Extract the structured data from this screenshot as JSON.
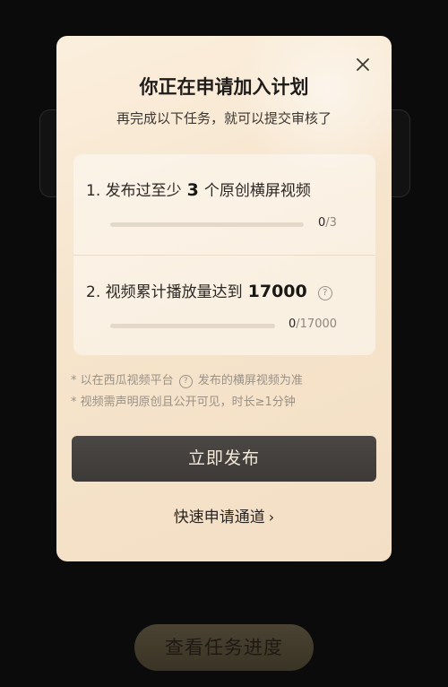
{
  "background": {
    "action_button": "查看任务进度"
  },
  "dialog": {
    "title": "你正在申请加入计划",
    "subtitle": "再完成以下任务，就可以提交审核了",
    "tasks": [
      {
        "prefix": "1. 发布过至少",
        "number": "3",
        "suffix": "个原创横屏视频",
        "has_help": false,
        "current": "0",
        "total": "/3",
        "progress": 0
      },
      {
        "prefix": "2. 视频累计播放量达到",
        "number": "17000",
        "suffix": "",
        "has_help": true,
        "current": "0",
        "total": "/17000",
        "progress": 0
      }
    ],
    "notes": {
      "line1_a": "* 以在西瓜视频平台",
      "line1_b": "发布的横屏视频为准",
      "line2": "* 视频需声明原创且公开可见，时长≥1分钟"
    },
    "primary_button": "立即发布",
    "fast_link": "快速申请通道",
    "icons": {
      "close": "close-icon",
      "help": "question-circle-icon",
      "chevron": "chevron-right-icon"
    }
  }
}
